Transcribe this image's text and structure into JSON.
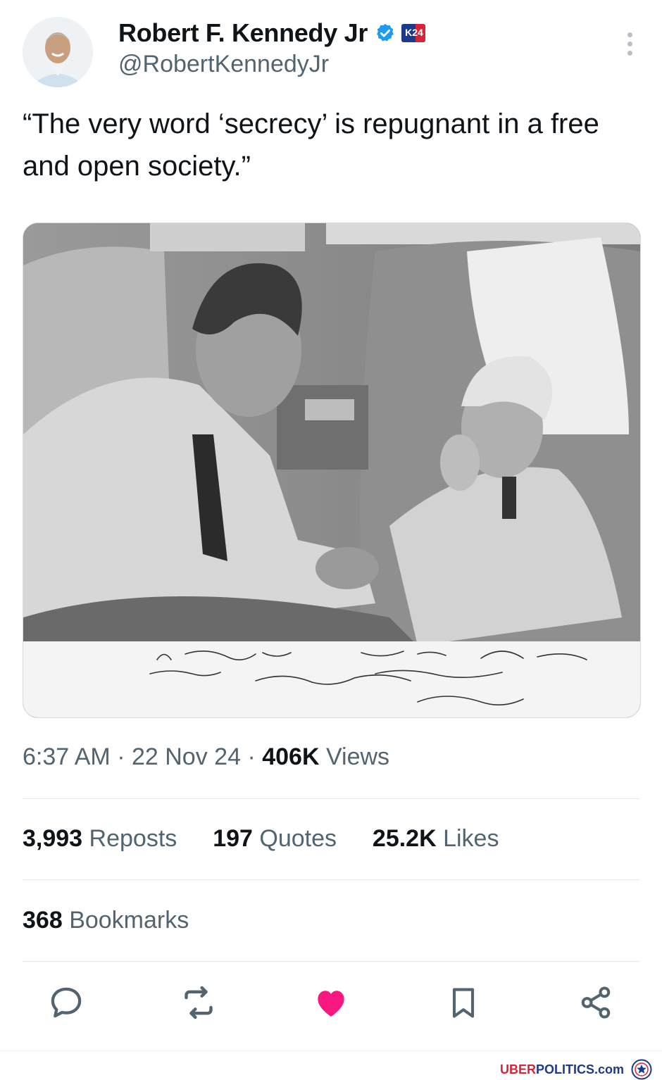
{
  "author": {
    "name": "Robert F. Kennedy Jr",
    "handle": "@RobertKennedyJr",
    "badge_text": "K24",
    "verified_color": "#1d9bf0"
  },
  "tweet": {
    "text": "“The very word ‘secrecy’ is repugnant in a free and open society.”"
  },
  "photo": {
    "inscription": "A President gets his advice from many sources - To Bobby - with the very best wishes John F. Kennedy"
  },
  "meta": {
    "time": "6:37 AM",
    "separator": "·",
    "date": "22 Nov 24",
    "views_count": "406K",
    "views_label": "Views"
  },
  "stats": {
    "reposts_count": "3,993",
    "reposts_label": "Reposts",
    "quotes_count": "197",
    "quotes_label": "Quotes",
    "likes_count": "25.2K",
    "likes_label": "Likes",
    "bookmarks_count": "368",
    "bookmarks_label": "Bookmarks"
  },
  "actions": {
    "icons": [
      "reply-icon",
      "repost-icon",
      "like-icon",
      "bookmark-icon",
      "share-icon"
    ],
    "liked_color": "#f91880",
    "icon_color": "#536471"
  },
  "watermark": {
    "part1": "UBER",
    "part2": "POLITICS.com"
  }
}
